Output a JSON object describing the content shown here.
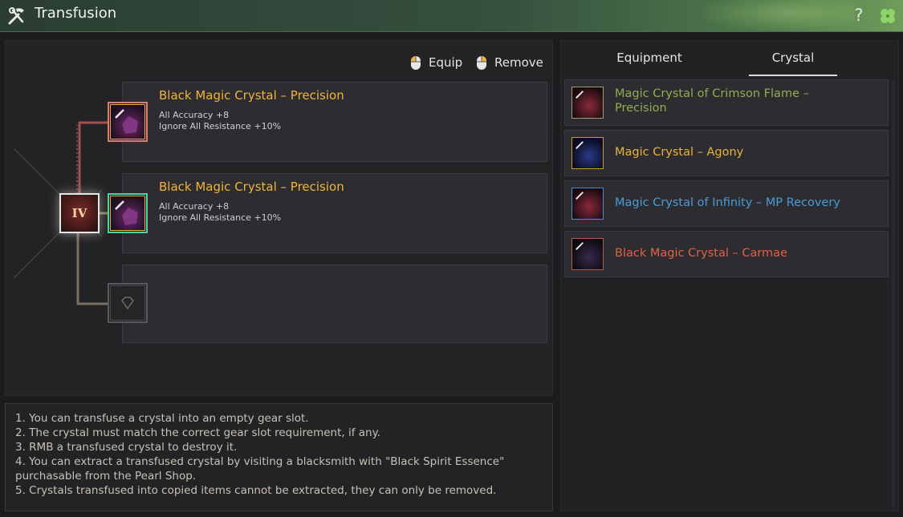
{
  "window": {
    "title": "Transfusion",
    "help_label": "?",
    "icons": {
      "title": "tools-icon",
      "clover": "clover-icon"
    }
  },
  "actions": {
    "equip_label": "Equip",
    "remove_label": "Remove"
  },
  "slots": [
    {
      "name": "Black Magic Crystal – Precision",
      "stats": [
        "All Accuracy +8",
        "Ignore All Resistance +10%"
      ]
    },
    {
      "name": "Black Magic Crystal – Precision",
      "stats": [
        "All Accuracy +8",
        "Ignore All Resistance +10%"
      ]
    },
    {
      "name": "",
      "stats": []
    }
  ],
  "gear": {
    "enhance_level": "IV"
  },
  "rules": [
    "1. You can transfuse a crystal into an empty gear slot.",
    "2. The crystal must match the correct gear slot requirement, if any.",
    "3. RMB a transfused crystal to destroy it.",
    "4. You can extract a transfused crystal by visiting a blacksmith with \"Black Spirit Essence\" purchasable from the Pearl Shop.",
    "5. Crystals transfused into copied items cannot be extracted, they can only be removed."
  ],
  "tabs": [
    {
      "label": "Equipment",
      "active": false
    },
    {
      "label": "Crystal",
      "active": true
    }
  ],
  "crystals": [
    {
      "name": "Magic Crystal of Crimson Flame – Precision",
      "color": "#8fae4f",
      "border": "#9aa070"
    },
    {
      "name": "Magic Crystal – Agony",
      "color": "#e8b23a",
      "border": "#c89a3a"
    },
    {
      "name": "Magic Crystal of Infinity – MP Recovery",
      "color": "#4a9bd6",
      "border": "#4a8fc8"
    },
    {
      "name": "Black Magic Crystal – Carmae",
      "color": "#e0604a",
      "border": "#b55a4e"
    }
  ],
  "colors": {
    "accent_gold": "#f0b43c",
    "slot_border_top": "#e07a80",
    "slot_border_mid": "#4fd1a8"
  }
}
